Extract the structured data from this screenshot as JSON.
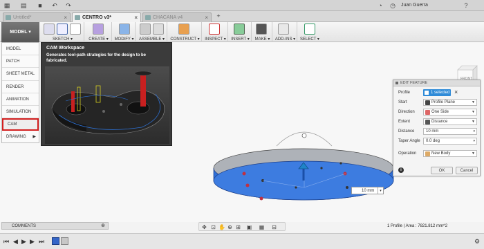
{
  "tabs": [
    {
      "label": "Untitled*",
      "active": false
    },
    {
      "label": "CENTRO v3*",
      "active": true
    },
    {
      "label": "CHACANA v4",
      "active": false
    }
  ],
  "user": {
    "name": "Juan Guerra"
  },
  "workspace": {
    "label": "MODEL"
  },
  "toolbar": {
    "groups": [
      {
        "label": "SKETCH ▾"
      },
      {
        "label": "CREATE ▾"
      },
      {
        "label": "MODIFY ▾"
      },
      {
        "label": "ASSEMBLE ▾"
      },
      {
        "label": "CONSTRUCT ▾"
      },
      {
        "label": "INSPECT ▾"
      },
      {
        "label": "INSERT ▾"
      },
      {
        "label": "MAKE ▾"
      },
      {
        "label": "ADD-INS ▾"
      },
      {
        "label": "SELECT ▾"
      }
    ]
  },
  "workspace_menu": {
    "items": [
      {
        "label": "MODEL"
      },
      {
        "label": "PATCH"
      },
      {
        "label": "SHEET METAL"
      },
      {
        "label": "RENDER"
      },
      {
        "label": "ANIMATION"
      },
      {
        "label": "SIMULATION"
      },
      {
        "label": "CAM"
      },
      {
        "label": "DRAWING"
      }
    ],
    "selected": "CAM"
  },
  "tooltip": {
    "title": "CAM Workspace",
    "description": "Generates tool-path strategies for the design to be fabricated."
  },
  "viewcube": {
    "label": "FRONT"
  },
  "edit_feature": {
    "title": "EDIT FEATURE",
    "profile": {
      "label": "Profile",
      "value": "1 selected"
    },
    "start": {
      "label": "Start",
      "value": "Profile Plane"
    },
    "direction": {
      "label": "Direction",
      "value": "One Side"
    },
    "extent": {
      "label": "Extent",
      "value": "Distance"
    },
    "distance": {
      "label": "Distance",
      "value": "10 mm"
    },
    "taper_angle": {
      "label": "Taper Angle",
      "value": "0.0 deg"
    },
    "operation": {
      "label": "Operation",
      "value": "New Body"
    },
    "ok_label": "OK",
    "cancel_label": "Cancel"
  },
  "dimension_input": {
    "value": "10 mm"
  },
  "comments": {
    "label": "COMMENTS"
  },
  "status": {
    "text": "1 Profile | Area : 7821.812 mm^2"
  },
  "colors": {
    "accent": "#2f8bd8",
    "selection_red": "#d31f1f",
    "extrude_blue": "#2f6fd8"
  }
}
